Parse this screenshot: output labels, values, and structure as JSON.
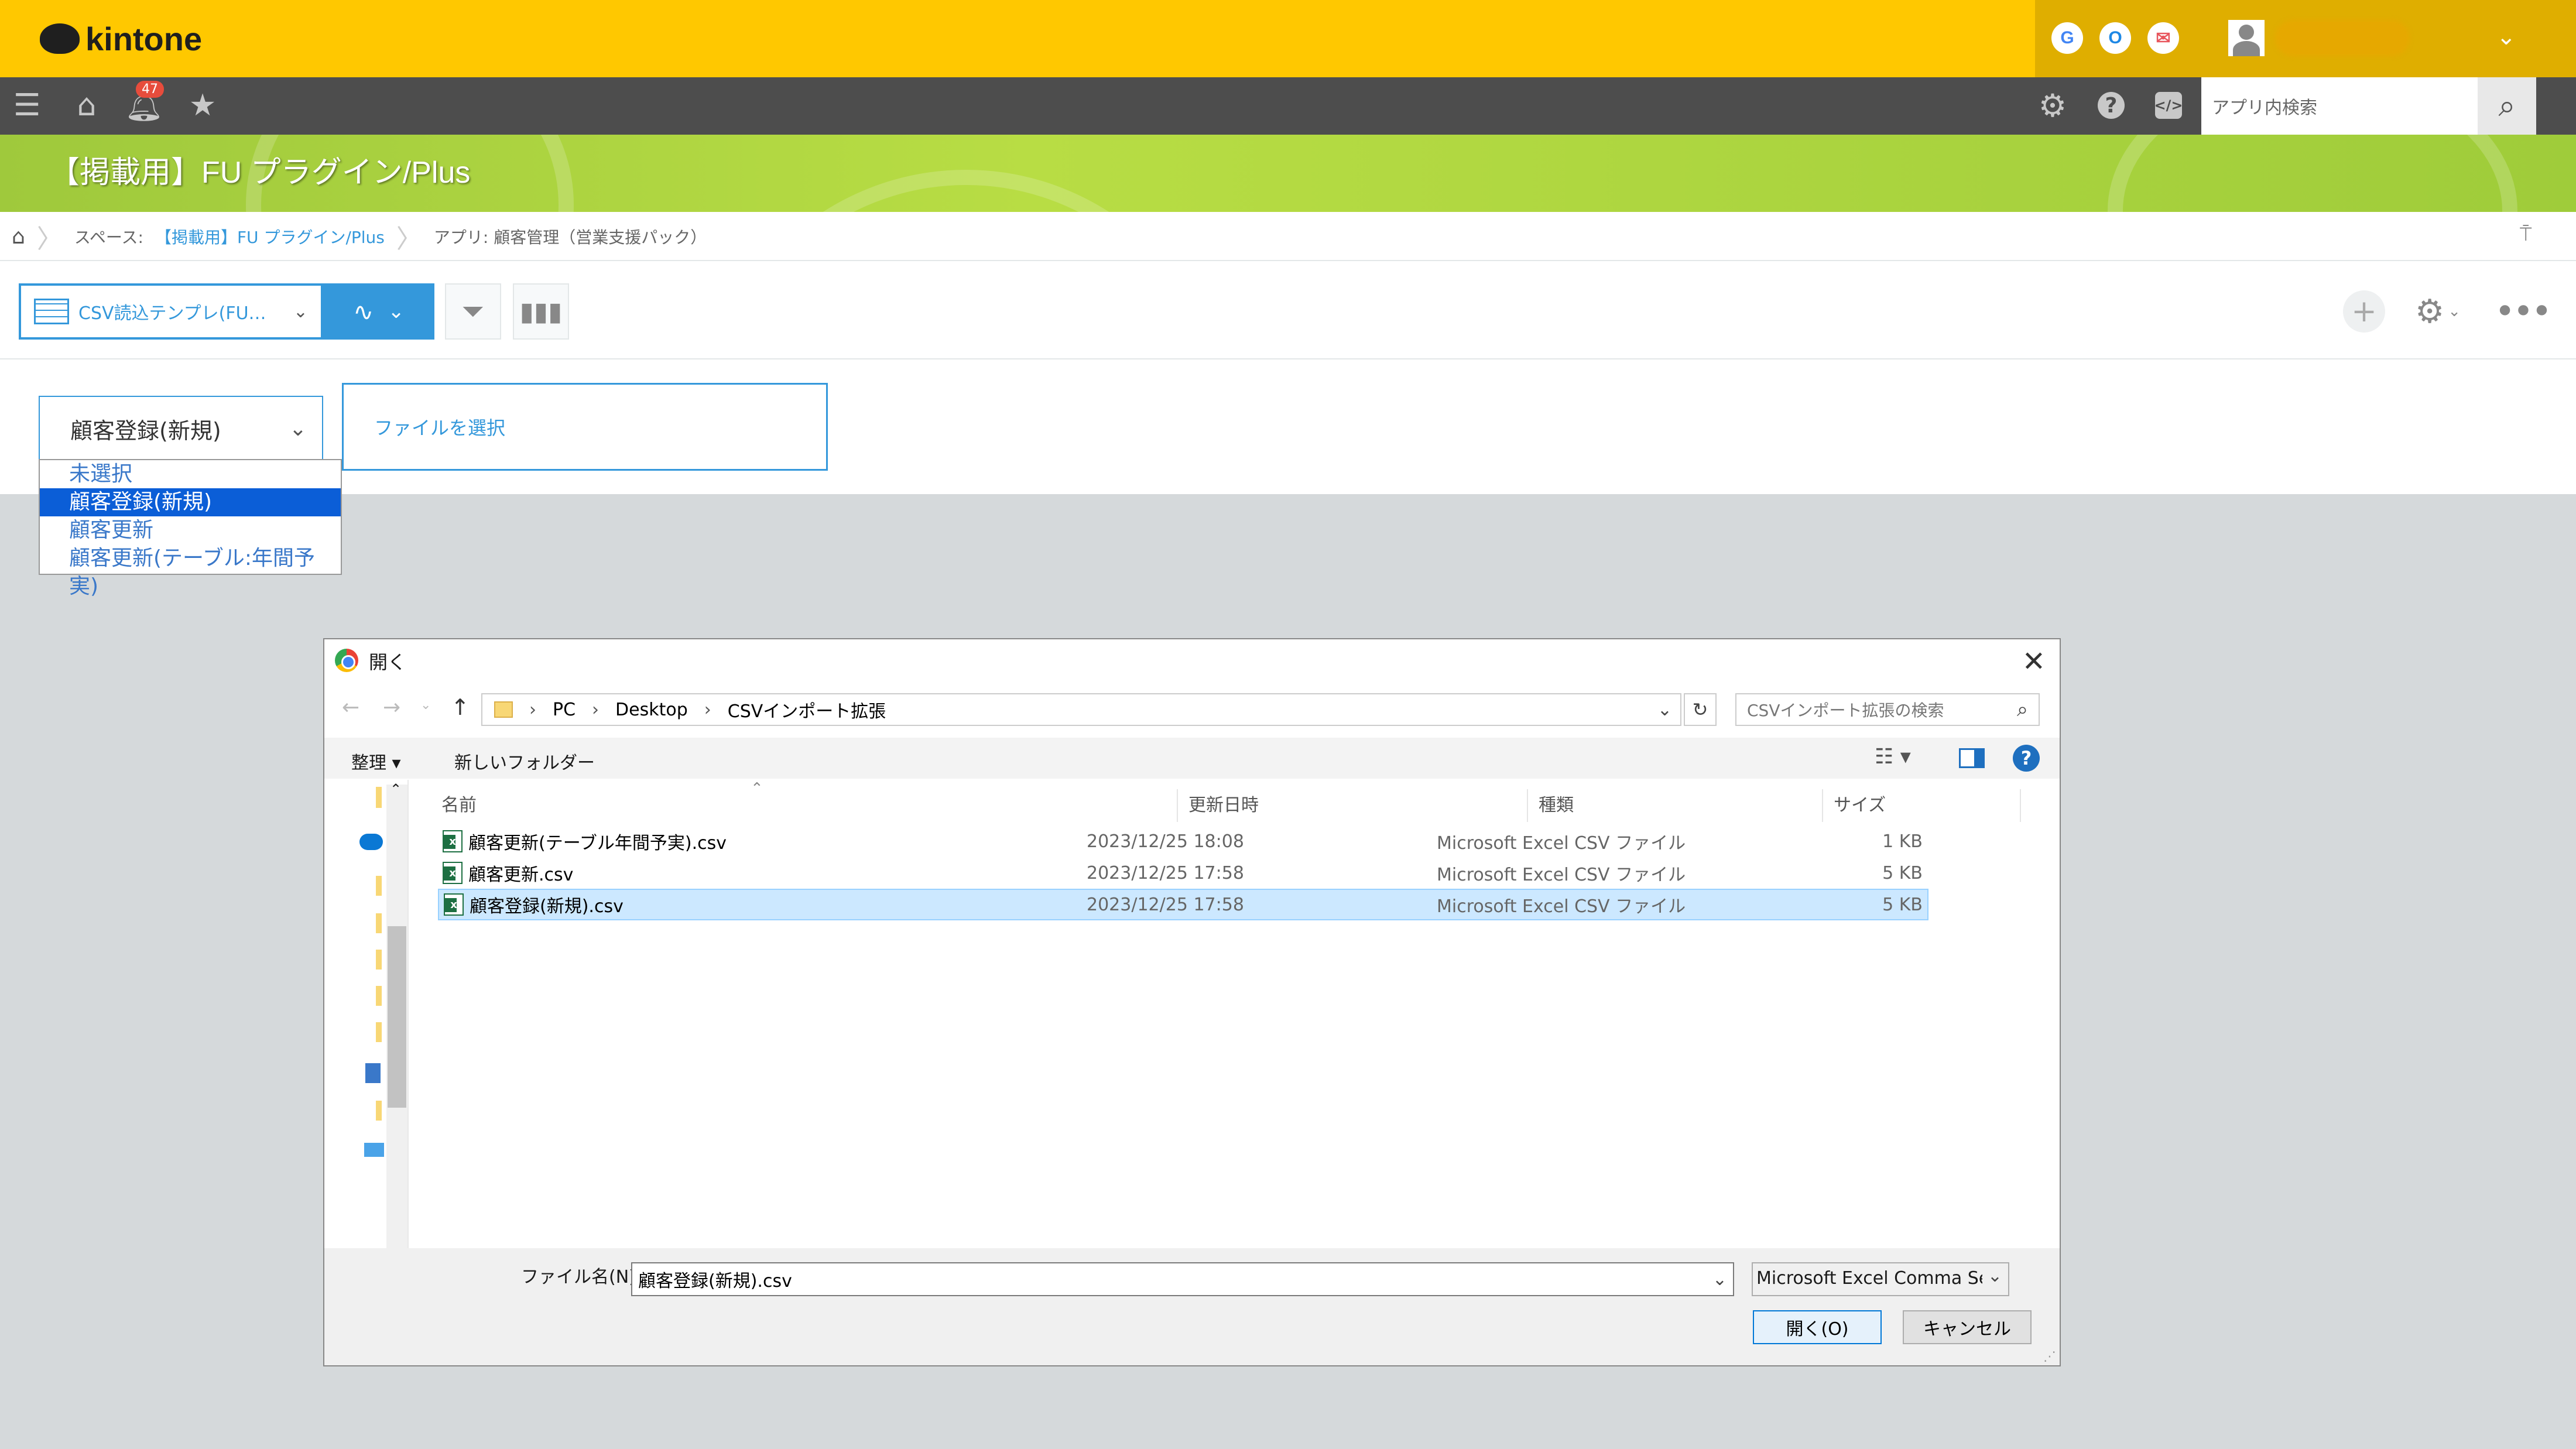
{
  "header": {
    "logo_text": "kintone",
    "services": [
      "G",
      "O",
      "✉"
    ],
    "brand_color": "#ffc800"
  },
  "navbar": {
    "notification_count": "47",
    "search_placeholder": "アプリ内検索"
  },
  "space": {
    "title": "【掲載用】FU プラグイン/Plus"
  },
  "breadcrumb": {
    "space_label": "スペース:",
    "space_link": "【掲載用】FU プラグイン/Plus",
    "app_label": "アプリ: 顧客管理（営業支援パック）"
  },
  "toolbar": {
    "view_name": "CSV読込テンプレ(FU…",
    "accent_color": "#3498db"
  },
  "import": {
    "selected_mode": "顧客登録(新規)",
    "file_button": "ファイルを選択",
    "options": [
      "未選択",
      "顧客登録(新規)",
      "顧客更新",
      "顧客更新(テーブル:年間予実)"
    ],
    "selected_index": 1
  },
  "dialog": {
    "title": "開く",
    "path": [
      "PC",
      "Desktop",
      "CSVインポート拡張"
    ],
    "search_placeholder": "CSVインポート拡張の検索",
    "organize": "整理 ▾",
    "new_folder": "新しいフォルダー",
    "columns": [
      "名前",
      "更新日時",
      "種類",
      "サイズ"
    ],
    "files": [
      {
        "name": "顧客更新(テーブル年間予実).csv",
        "date": "2023/12/25 18:08",
        "type": "Microsoft Excel CSV ファイル",
        "size": "1 KB"
      },
      {
        "name": "顧客更新.csv",
        "date": "2023/12/25 17:58",
        "type": "Microsoft Excel CSV ファイル",
        "size": "5 KB"
      },
      {
        "name": "顧客登録(新規).csv",
        "date": "2023/12/25 17:58",
        "type": "Microsoft Excel CSV ファイル",
        "size": "5 KB"
      }
    ],
    "selected_file_index": 2,
    "filename_label": "ファイル名(N):",
    "filename_value": "顧客登録(新規).csv",
    "filetype_value": "Microsoft Excel Comma Separat",
    "open_button": "開く(O)",
    "cancel_button": "キャンセル"
  }
}
